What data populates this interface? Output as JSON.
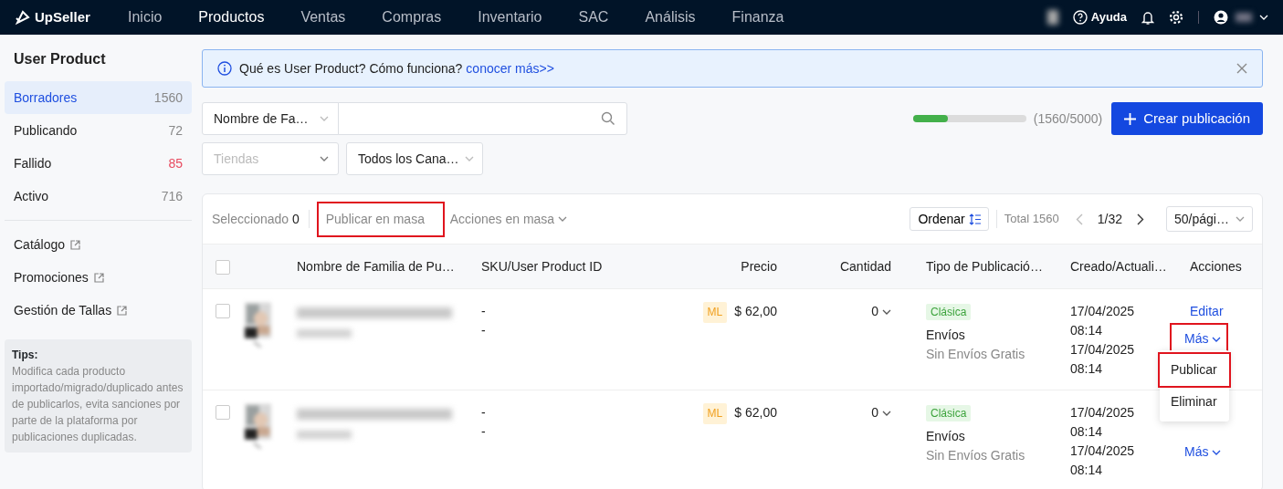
{
  "nav": {
    "logo": "UpSeller",
    "items": [
      {
        "label": "Inicio",
        "selected": false
      },
      {
        "label": "Productos",
        "selected": true
      },
      {
        "label": "Ventas",
        "selected": false
      },
      {
        "label": "Compras",
        "selected": false
      },
      {
        "label": "Inventario",
        "selected": false
      },
      {
        "label": "SAC",
        "selected": false
      },
      {
        "label": "Análisis",
        "selected": false
      },
      {
        "label": "Finanza",
        "selected": false
      }
    ],
    "help": "Ayuda"
  },
  "sidebar": {
    "title": "User Product",
    "items": [
      {
        "label": "Borradores",
        "count": "1560",
        "selected": true,
        "alert": false
      },
      {
        "label": "Publicando",
        "count": "72",
        "selected": false,
        "alert": false
      },
      {
        "label": "Fallido",
        "count": "85",
        "selected": false,
        "alert": true
      },
      {
        "label": "Activo",
        "count": "716",
        "selected": false,
        "alert": false
      }
    ],
    "links": [
      "Catálogo",
      "Promociones",
      "Gestión de Tallas"
    ],
    "tips": {
      "title": "Tips:",
      "text": "Modifica cada producto importado/migrado/duplicado antes de publicarlos, evita sanciones por parte de la plataforma por publicaciones duplicadas."
    }
  },
  "notice": {
    "text": "Qué es User Product? Cómo funciona?",
    "link": "conocer más>>"
  },
  "filters": {
    "search_type": "Nombre de Fa…",
    "store_placeholder": "Tiendas",
    "channel": "Todos los Cana…"
  },
  "quota": {
    "level": 0.312,
    "text": "(1560/5000)"
  },
  "create_button": "Crear publicación",
  "toolbar": {
    "selected_label": "Seleccionado",
    "selected_count": "0",
    "bulk_publish": {
      "label": "Publicar en masa",
      "highlighted": true
    },
    "bulk_actions": "Acciones en masa",
    "sort": "Ordenar",
    "total": "Total 1560",
    "page": "1/32",
    "page_size": "50/pági…"
  },
  "table": {
    "select_all_checked": false,
    "columns": [
      "Nombre de Familia de Pu…",
      "SKU/User Product ID",
      "Precio",
      "Cantidad",
      "Tipo de Publicació…",
      "Creado/Actuali…",
      "Acciones"
    ],
    "rows": [
      {
        "checked": false,
        "sku": [
          "-",
          "-"
        ],
        "channel_tag": "ML",
        "price": "$ 62,00",
        "quantity": "0",
        "type_tag": "Clásica",
        "shipping": "Envíos",
        "shipping_note": "Sin Envíos Gratis",
        "dates": [
          "17/04/2025 08:14",
          "17/04/2025 08:14"
        ],
        "actions": [
          {
            "kind": "link",
            "label": "Editar"
          },
          {
            "kind": "more",
            "label": "Más",
            "highlighted": true
          }
        ]
      },
      {
        "checked": false,
        "sku": [
          "-",
          "-"
        ],
        "channel_tag": "ML",
        "price": "$ 62,00",
        "quantity": "0",
        "type_tag": "Clásica",
        "shipping": "Envíos",
        "shipping_note": "Sin Envíos Gratis",
        "dates": [
          "17/04/2025 08:14",
          "17/04/2025 08:14"
        ],
        "actions": [
          {
            "kind": "more",
            "label": "Más",
            "highlighted": false
          }
        ]
      }
    ]
  },
  "menu": {
    "items": [
      {
        "label": "Publicar",
        "highlighted": true
      },
      {
        "label": "Eliminar",
        "highlighted": false
      }
    ]
  }
}
